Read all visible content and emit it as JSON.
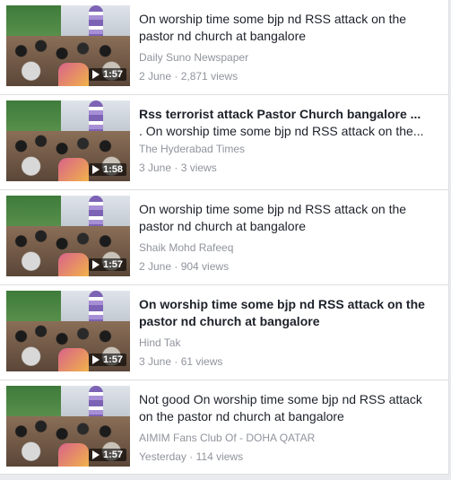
{
  "videos": [
    {
      "title": "On worship time some bjp nd RSS attack on the pastor nd church at bangalore",
      "subtitle": "",
      "channel": "Daily Suno Newspaper",
      "date": "2 June",
      "views": "2,871 views",
      "duration": "1:57",
      "bold": false
    },
    {
      "title": "Rss terrorist attack Pastor Church bangalore ...",
      "subtitle": ". On worship time some bjp nd RSS attack on the...",
      "channel": "The Hyderabad Times",
      "date": "3 June",
      "views": "3 views",
      "duration": "1:58",
      "bold": true
    },
    {
      "title": "On worship time some bjp nd RSS attack on the pastor nd church at bangalore",
      "subtitle": "",
      "channel": "Shaik Mohd Rafeeq",
      "date": "2 June",
      "views": "904 views",
      "duration": "1:57",
      "bold": false
    },
    {
      "title": "On worship time some bjp nd RSS attack on the pastor nd church at bangalore",
      "subtitle": "",
      "channel": "Hind Tak",
      "date": "3 June",
      "views": "61 views",
      "duration": "1:57",
      "bold": true
    },
    {
      "title": "Not good On worship time some bjp nd RSS attack on the pastor nd church at bangalore",
      "subtitle": "",
      "channel": "AIMIM Fans Club Of - DOHA QATAR",
      "date": "Yesterday",
      "views": "114 views",
      "duration": "1:57",
      "bold": false
    }
  ],
  "separator": " · "
}
